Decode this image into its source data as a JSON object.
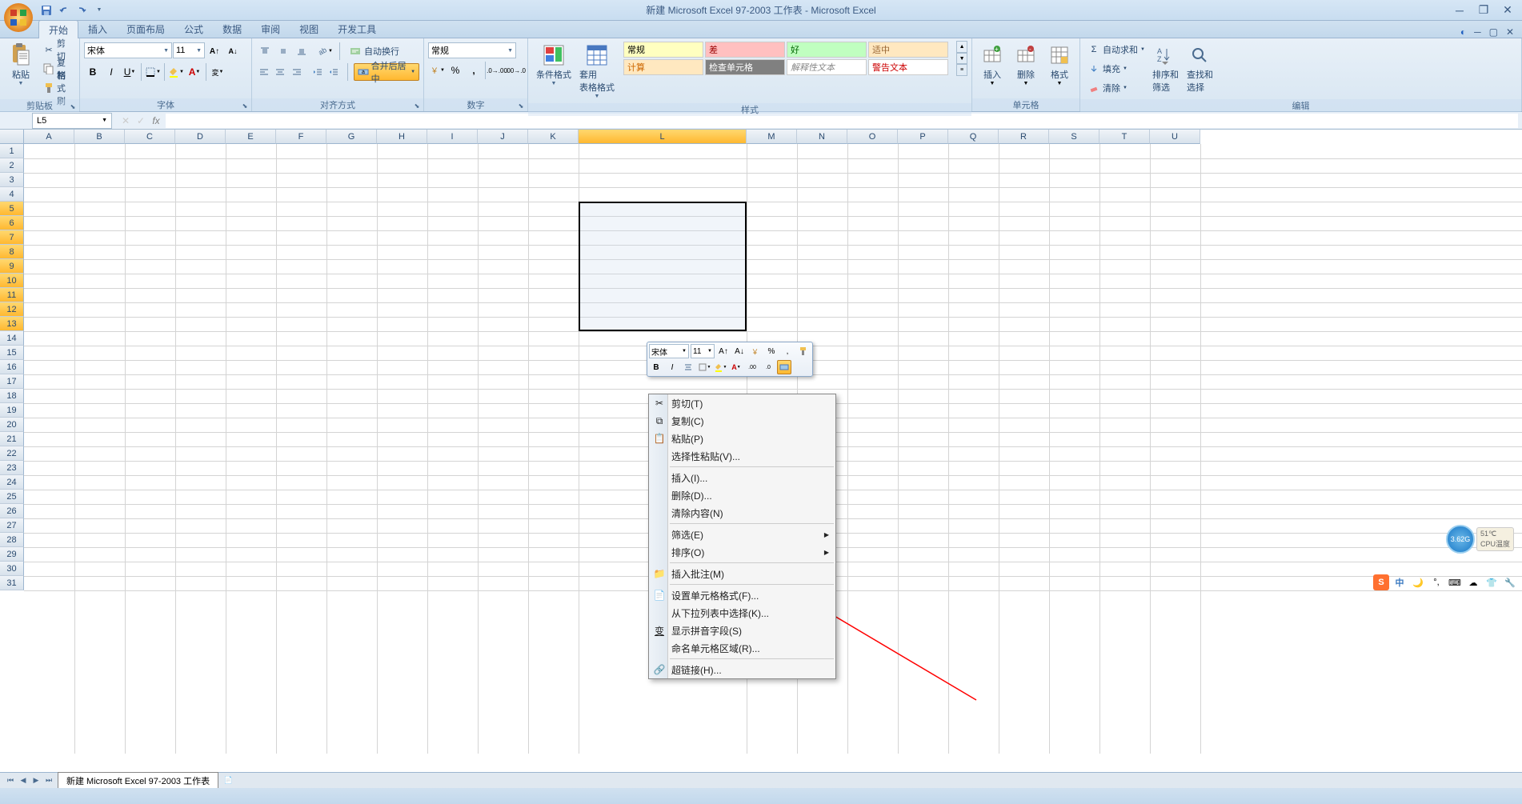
{
  "title": "新建 Microsoft Excel 97-2003 工作表 - Microsoft Excel",
  "tabs": [
    "开始",
    "插入",
    "页面布局",
    "公式",
    "数据",
    "审阅",
    "视图",
    "开发工具"
  ],
  "active_tab": 0,
  "clipboard": {
    "label": "剪贴板",
    "paste": "粘贴",
    "cut": "剪切",
    "copy": "复制",
    "fmtpainter": "格式刷"
  },
  "font": {
    "label": "字体",
    "name": "宋体",
    "size": "11"
  },
  "align": {
    "label": "对齐方式",
    "wrap": "自动换行",
    "merge": "合并后居中"
  },
  "number": {
    "label": "数字",
    "format": "常规"
  },
  "styles_group": {
    "label": "样式",
    "cond": "条件格式",
    "table": "套用\n表格格式"
  },
  "style_cells": [
    {
      "text": "常规",
      "bg": "#ffffc0",
      "color": "#000"
    },
    {
      "text": "差",
      "bg": "#ffc0c0",
      "color": "#900"
    },
    {
      "text": "好",
      "bg": "#c0ffc0",
      "color": "#060"
    },
    {
      "text": "适中",
      "bg": "#ffe8c0",
      "color": "#963"
    },
    {
      "text": "计算",
      "bg": "#ffe8c0",
      "color": "#c60"
    },
    {
      "text": "检查单元格",
      "bg": "#808080",
      "color": "#fff"
    },
    {
      "text": "解释性文本",
      "bg": "#fff",
      "color": "#888",
      "italic": true
    },
    {
      "text": "警告文本",
      "bg": "#fff",
      "color": "#c00"
    }
  ],
  "cells_group": {
    "label": "单元格",
    "insert": "插入",
    "delete": "删除",
    "format": "格式"
  },
  "editing": {
    "label": "编辑",
    "sum": "自动求和",
    "fill": "填充",
    "clear": "清除",
    "sort": "排序和\n筛选",
    "find": "查找和\n选择"
  },
  "namebox": "L5",
  "columns": [
    "A",
    "B",
    "C",
    "D",
    "E",
    "F",
    "G",
    "H",
    "I",
    "J",
    "K",
    "L",
    "M",
    "N",
    "O",
    "P",
    "Q",
    "R",
    "S",
    "T",
    "U"
  ],
  "col_widths": {
    "default": 63,
    "L": 210
  },
  "active_col": "L",
  "row_count": 31,
  "active_rows": [
    5,
    6,
    7,
    8,
    9,
    10,
    11,
    12,
    13
  ],
  "mini_toolbar": {
    "font": "宋体",
    "size": "11"
  },
  "context_menu": [
    {
      "type": "item",
      "text": "剪切(T)",
      "icon": "cut"
    },
    {
      "type": "item",
      "text": "复制(C)",
      "icon": "copy"
    },
    {
      "type": "item",
      "text": "粘贴(P)",
      "icon": "paste"
    },
    {
      "type": "item",
      "text": "选择性粘贴(V)..."
    },
    {
      "type": "sep"
    },
    {
      "type": "item",
      "text": "插入(I)..."
    },
    {
      "type": "item",
      "text": "删除(D)..."
    },
    {
      "type": "item",
      "text": "清除内容(N)"
    },
    {
      "type": "sep"
    },
    {
      "type": "item",
      "text": "筛选(E)",
      "submenu": true
    },
    {
      "type": "item",
      "text": "排序(O)",
      "submenu": true
    },
    {
      "type": "sep"
    },
    {
      "type": "item",
      "text": "插入批注(M)",
      "icon": "comment"
    },
    {
      "type": "sep"
    },
    {
      "type": "item",
      "text": "设置单元格格式(F)...",
      "icon": "format"
    },
    {
      "type": "item",
      "text": "从下拉列表中选择(K)..."
    },
    {
      "type": "item",
      "text": "显示拼音字段(S)",
      "icon": "pinyin"
    },
    {
      "type": "item",
      "text": "命名单元格区域(R)..."
    },
    {
      "type": "sep"
    },
    {
      "type": "item",
      "text": "超链接(H)...",
      "icon": "link"
    }
  ],
  "sheet_tab": "新建 Microsoft Excel 97-2003 工作表",
  "cpu_widget": {
    "disk": "3.62G",
    "temp_val": "51℃",
    "temp_lbl": "CPU温度"
  },
  "ime": {
    "logo": "S",
    "lang": "中"
  }
}
